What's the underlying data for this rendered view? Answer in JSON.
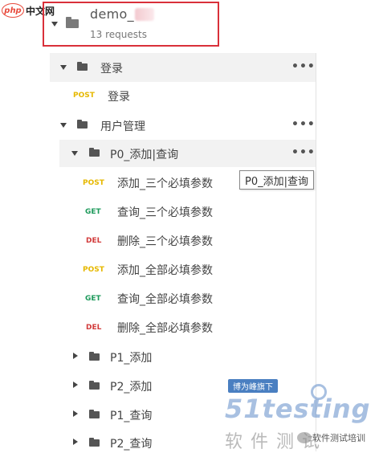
{
  "site_logo": {
    "badge": "php",
    "text": "中文网"
  },
  "collection": {
    "name": "demo_",
    "count": "13 requests"
  },
  "folders": {
    "login": {
      "label": "登录",
      "more": "•••"
    },
    "user_mgmt": {
      "label": "用户管理",
      "more": "•••"
    },
    "p0": {
      "label": "P0_添加|查询",
      "more": "•••"
    }
  },
  "requests": [
    {
      "method": "POST",
      "label": "登录"
    },
    {
      "method": "POST",
      "label": "添加_三个必填参数"
    },
    {
      "method": "GET",
      "label": "查询_三个必填参数"
    },
    {
      "method": "DEL",
      "label": "删除_三个必填参数"
    },
    {
      "method": "POST",
      "label": "添加_全部必填参数"
    },
    {
      "method": "GET",
      "label": "查询_全部必填参数"
    },
    {
      "method": "DEL",
      "label": "删除_全部必填参数"
    }
  ],
  "subfolders": [
    {
      "label": "P1_添加"
    },
    {
      "label": "P2_添加"
    },
    {
      "label": "P1_查询"
    },
    {
      "label": "P2_查询"
    }
  ],
  "tooltip": "P0_添加|查询",
  "watermark": {
    "banner": "博为峰旗下",
    "logo": "51testing",
    "chars": "软件测试",
    "account": "软件测试培训"
  },
  "colors": {
    "post": "#e6b800",
    "get": "#1d9a5b",
    "del": "#d23a3a",
    "highlight_border": "#d9303a"
  }
}
